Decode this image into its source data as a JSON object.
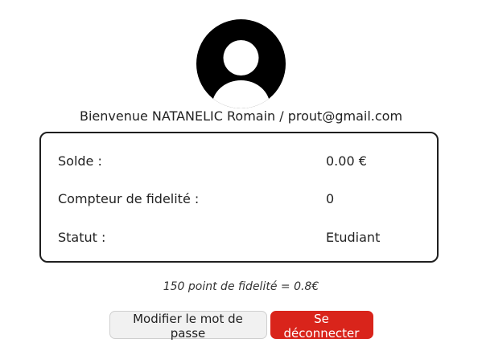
{
  "profile": {
    "avatar_icon": "user-avatar-icon",
    "welcome_text": "Bienvenue NATANELIC Romain / prout@gmail.com"
  },
  "account_info": {
    "rows": [
      {
        "label": "Solde :",
        "value": "0.00 €"
      },
      {
        "label": "Compteur de fidelité :",
        "value": "0"
      },
      {
        "label": "Statut :",
        "value": "Etudiant"
      }
    ]
  },
  "loyalty_note": "150 point de fidelité = 0.8€",
  "actions": {
    "change_password_label": "Modifier le mot de passe",
    "logout_label": "Se déconnecter"
  },
  "colors": {
    "logout_button": "#d9241b",
    "box_border": "#1f1f1f",
    "avatar": "#000000"
  }
}
